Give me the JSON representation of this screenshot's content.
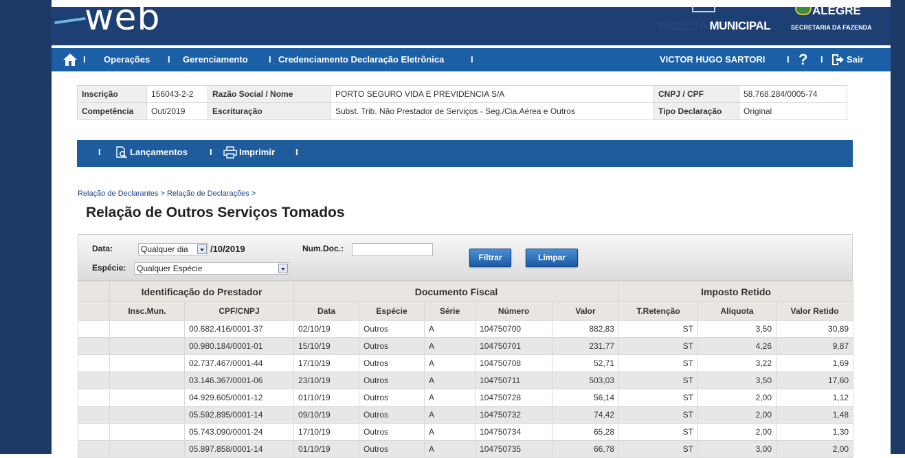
{
  "header": {
    "logo_text": "web",
    "receita_part1": "RECEITA",
    "receita_part2": "MUNICIPAL",
    "city": "ALEGRE",
    "secretaria": "SECRETARIA DA FAZENDA"
  },
  "main_nav": {
    "sep": "I",
    "items": [
      "Operações",
      "Gerenciamento",
      "Credenciamento Declaração Eletrônica"
    ],
    "user": "VICTOR HUGO SARTORI",
    "help": "?",
    "logout": "Sair",
    "home_icon": "home-icon",
    "help_icon": "help-icon",
    "logout_icon": "logout-icon"
  },
  "info": {
    "inscricao_label": "Inscrição",
    "inscricao_value": "156043-2-2",
    "razao_label": "Razão Social / Nome",
    "razao_value": "PORTO SEGURO VIDA E PREVIDENCIA S/A",
    "cnpj_label": "CNPJ / CPF",
    "cnpj_value": "58.768.284/0005-74",
    "competencia_label": "Competência",
    "competencia_value": "Out/2019",
    "escrituracao_label": "Escrituração",
    "escrituracao_value": "Subst. Trib. Não Prestador de Serviços - Seg./Cia.Aérea e Outros",
    "tipo_label": "Tipo Declaração",
    "tipo_value": "Original"
  },
  "sub_nav": {
    "sep": "I",
    "lancamentos": "Lançamentos",
    "imprimir": "Imprimir",
    "lancamentos_icon": "document-search-icon",
    "imprimir_icon": "printer-icon"
  },
  "breadcrumb": {
    "item1": "Relação de Declarantes",
    "sep": " > ",
    "item2": "Relação de Declarações",
    "trailing": " >"
  },
  "page_title": "Relação de Outros Serviços Tomados",
  "filter": {
    "data_label": "Data:",
    "data_value": "Qualquer dia",
    "data_suffix": "/10/2019",
    "numdoc_label": "Num.Doc.:",
    "numdoc_value": "",
    "especie_label": "Espécie:",
    "especie_value": "Qualquer Espécie",
    "filtrar": "Filtrar",
    "limpar": "Limpar"
  },
  "table": {
    "groups": [
      "Identificação do Prestador",
      "Documento Fiscal",
      "Imposto Retido"
    ],
    "columns": [
      "Insc.Mun.",
      "CPF/CNPJ",
      "Data",
      "Espécie",
      "Série",
      "Número",
      "Valor",
      "T.Retenção",
      "Alíquota",
      "Valor Retido"
    ],
    "rows": [
      [
        "",
        "00.682.416/0001-37",
        "02/10/19",
        "Outros",
        "A",
        "104750700",
        "882,83",
        "ST",
        "3,50",
        "30,89"
      ],
      [
        "",
        "00.980.184/0001-01",
        "15/10/19",
        "Outros",
        "A",
        "104750701",
        "231,77",
        "ST",
        "4,26",
        "9,87"
      ],
      [
        "",
        "02.737.467/0001-44",
        "17/10/19",
        "Outros",
        "A",
        "104750708",
        "52,71",
        "ST",
        "3,22",
        "1,69"
      ],
      [
        "",
        "03.146.367/0001-06",
        "23/10/19",
        "Outros",
        "A",
        "104750711",
        "503,03",
        "ST",
        "3,50",
        "17,60"
      ],
      [
        "",
        "04.929.605/0001-12",
        "01/10/19",
        "Outros",
        "A",
        "104750728",
        "56,14",
        "ST",
        "2,00",
        "1,12"
      ],
      [
        "",
        "05.592.895/0001-14",
        "09/10/19",
        "Outros",
        "A",
        "104750732",
        "74,42",
        "ST",
        "2,00",
        "1,48"
      ],
      [
        "",
        "05.743.090/0001-24",
        "17/10/19",
        "Outros",
        "A",
        "104750734",
        "65,28",
        "ST",
        "2,00",
        "1,30"
      ],
      [
        "",
        "05.897.858/0001-14",
        "01/10/19",
        "Outros",
        "A",
        "104750735",
        "66,78",
        "ST",
        "3,00",
        "2,00"
      ]
    ]
  }
}
